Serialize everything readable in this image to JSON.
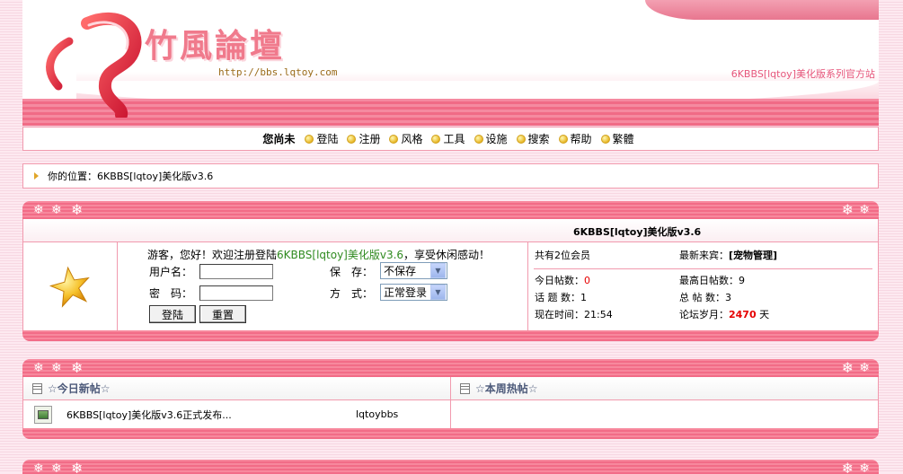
{
  "header": {
    "logo_text": "竹風論壇",
    "url": "http://bbs.lqtoy.com",
    "tagline": "6KBBS[lqtoy]美化版系列官方站"
  },
  "nav": {
    "guest_label": "您尚未",
    "items": [
      {
        "label": "登陆"
      },
      {
        "label": "注册"
      },
      {
        "label": "风格"
      },
      {
        "label": "工具"
      },
      {
        "label": "设施"
      },
      {
        "label": "搜索"
      },
      {
        "label": "帮助"
      },
      {
        "label": "繁體"
      }
    ]
  },
  "breadcrumb": {
    "text": "你的位置：6KBBS[lqtoy]美化版v3.6"
  },
  "forum_info": {
    "title": "6KBBS[lqtoy]美化版v3.6",
    "welcome_prefix": "游客，您好！欢迎注册登陆",
    "welcome_site": "6KBBS[lqtoy]美化版v3.6",
    "welcome_suffix": "，享受休闲感动！",
    "username_label": "用户名：",
    "password_label": "密　码：",
    "save_label": "保　存：",
    "save_value": "不保存",
    "mode_label": "方　式：",
    "mode_value": "正常登录",
    "login_button": "登陆",
    "reset_button": "重置",
    "members_text": "共有2位会员",
    "newest_label": "最新来宾：",
    "newest_value": "[宠物管理]",
    "today_label": "今日帖数：",
    "today_value": "0",
    "max_label": "最高日帖数：",
    "max_value": "9",
    "topics_label": "话 题 数：",
    "topics_value": "1",
    "posts_label": "总 帖 数：",
    "posts_value": "3",
    "time_label": "现在时间：",
    "time_value": "21:54",
    "age_label": "论坛岁月：",
    "age_value": "2470",
    "age_unit": "天"
  },
  "new_posts": {
    "today_header": "☆今日新帖☆",
    "week_header": "☆本周热帖☆",
    "rows": [
      {
        "title": "6KBBS[lqtoy]美化版v3.6正式发布...",
        "author": "lqtoybbs"
      }
    ]
  },
  "colors": {
    "accent_pink": "#f26c87",
    "border_pink": "#f19aae",
    "stat_red": "#e60000",
    "welcome_green": "#2f8a1f"
  }
}
